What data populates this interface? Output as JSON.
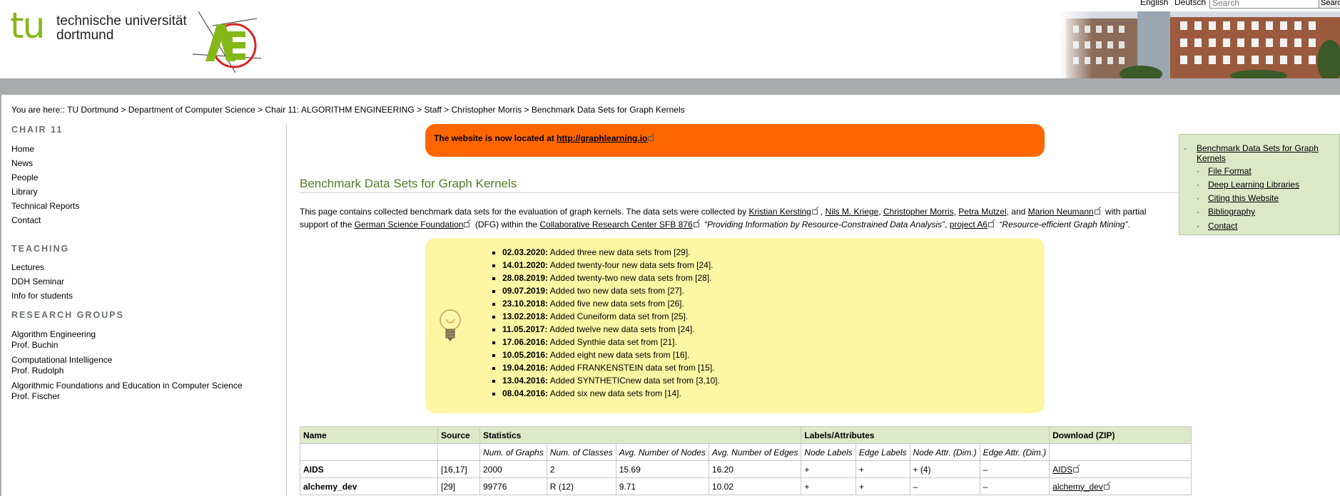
{
  "header": {
    "logo_tu": "tu",
    "university_line1": "technische universität",
    "university_line2": "dortmund",
    "lang_en": "English",
    "lang_de": "Deutsch",
    "search_placeholder": "Search",
    "search_button": "Search"
  },
  "breadcrumb": "You are here:: TU Dortmund > Department of Computer Science > Chair 11: ALGORITHM ENGINEERING > Staff > Christopher Morris > Benchmark Data Sets for Graph Kernels",
  "nav": {
    "chair_heading": "CHAIR 11",
    "chair_items": [
      "Home",
      "News",
      "People",
      "Library",
      "Technical Reports",
      "Contact"
    ],
    "teaching_heading": "TEACHING",
    "teaching_items": [
      "Lectures",
      "DDH Seminar",
      "Info for students"
    ],
    "research_heading": "RESEARCH GROUPS",
    "research_items": [
      {
        "name": "Algorithm Engineering",
        "prof": "Prof. Buchin"
      },
      {
        "name": "Computational Intelligence",
        "prof": "Prof. Rudolph"
      },
      {
        "name": "Algorithmic Foundations and Education in Computer Science",
        "prof": "Prof. Fischer"
      }
    ]
  },
  "notice": {
    "text": "The website is now located at ",
    "link": "http://graphlearning.io"
  },
  "page_title": "Benchmark Data Sets for Graph Kernels",
  "intro": {
    "t1": "This page contains collected benchmark data sets for the evaluation of graph kernels. The data sets were collected by ",
    "names": [
      "Kristian Kersting",
      "Nils M. Kriege",
      "Christopher Morris",
      "Petra Mutzel",
      "Marion Neumann"
    ],
    "t2": " with partial support of the ",
    "dfg": "German Science Foundation",
    "t3": " (DFG) within the ",
    "crc": "Collaborative Research Center SFB 876",
    "quote1": "“Providing Information by Resource-Constrained Data Analysis”",
    "project": "project A6",
    "quote2": "“Resource-efficient Graph Mining”",
    "sep_and": ", and ",
    "sep_comma": ", ",
    "period": "."
  },
  "updates": [
    {
      "date": "02.03.2020:",
      "text": " Added three new data sets from [29]."
    },
    {
      "date": "14.01.2020:",
      "text": " Added twenty-four new data sets from [24]."
    },
    {
      "date": "28.08.2019:",
      "text": " Added twenty-two new data sets from [28]."
    },
    {
      "date": "09.07.2019:",
      "text": " Added two new data sets from [27]."
    },
    {
      "date": "23.10.2018:",
      "text": " Added five new data sets from [26]."
    },
    {
      "date": "13.02.2018:",
      "text": " Added Cuneiform data set from [25]."
    },
    {
      "date": "11.05.2017:",
      "text": " Added twelve new data sets from [24]."
    },
    {
      "date": "17.06.2016:",
      "text": " Added Synthie data set from [21]."
    },
    {
      "date": "10.05.2016:",
      "text": " Added eight new data sets from [16]."
    },
    {
      "date": "19.04.2016:",
      "text": " Added FRANKENSTEIN data set from [15]."
    },
    {
      "date": "13.04.2016:",
      "text": " Added SYNTHETICnew data set from [3,10]."
    },
    {
      "date": "08.04.2016:",
      "text": " Added six new data sets from [14]."
    }
  ],
  "toc": {
    "main": "Benchmark Data Sets for Graph Kernels",
    "items": [
      "File Format",
      "Deep Learning Libraries",
      "Citing this Website",
      "Bibliography",
      "Contact"
    ]
  },
  "table": {
    "headers": [
      "Name",
      "Source",
      "Statistics",
      "Labels/Attributes",
      "Download (ZIP)"
    ],
    "subheaders": [
      "Num. of Graphs",
      "Num. of Classes",
      "Avg. Number of Nodes",
      "Avg. Number of Edges",
      "Node Labels",
      "Edge Labels",
      "Node Attr. (Dim.)",
      "Edge Attr. (Dim.)"
    ],
    "rows": [
      {
        "name": "AIDS",
        "source": "[16,17]",
        "graphs": "2000",
        "classes": "2",
        "nodes": "15.69",
        "edges": "16.20",
        "nl": "+",
        "el": "+",
        "na": "+ (4)",
        "ea": "–",
        "dl": "AIDS"
      },
      {
        "name": "alchemy_dev",
        "source": "[29]",
        "graphs": "99776",
        "classes": "R (12)",
        "nodes": "9.71",
        "edges": "10.02",
        "nl": "+",
        "el": "+",
        "na": "–",
        "ea": "–",
        "dl": "alchemy_dev"
      }
    ]
  }
}
